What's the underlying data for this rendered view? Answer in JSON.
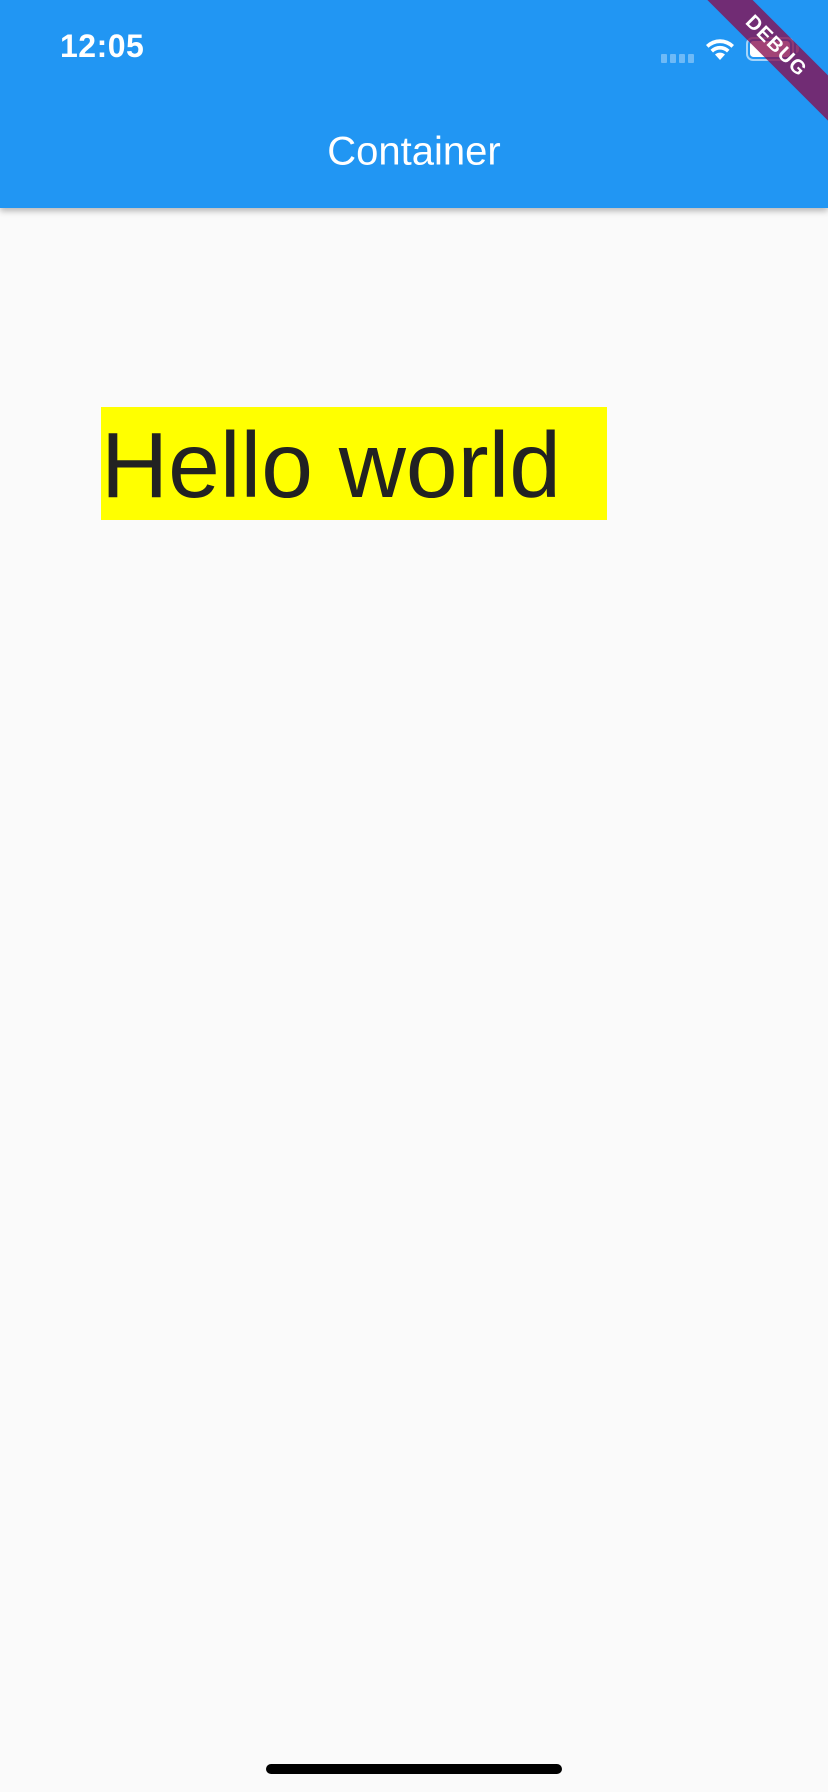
{
  "status_bar": {
    "time": "12:05"
  },
  "app_bar": {
    "title": "Container",
    "background_color": "#2196f3"
  },
  "debug_banner": {
    "label": "DEBUG"
  },
  "container": {
    "text": "Hello world",
    "background_color": "#ffff00"
  },
  "icons": [
    "cellular-signal-icon",
    "wifi-icon",
    "battery-icon"
  ]
}
